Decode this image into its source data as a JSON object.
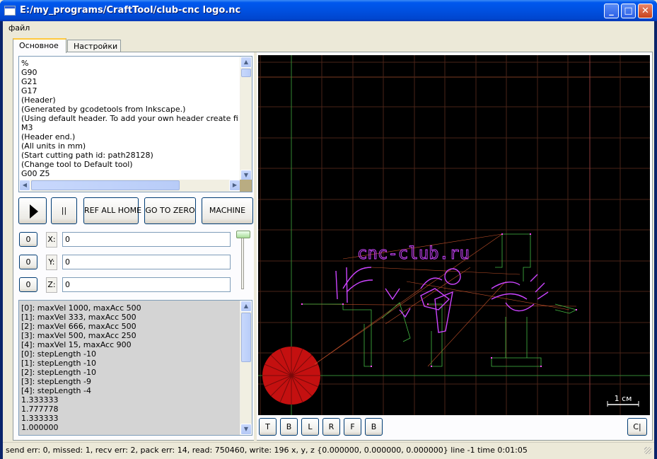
{
  "window": {
    "title": "E:/my_programs/CraftTool/club-cnc logo.nc",
    "minimize": "_",
    "maximize": "□",
    "close": "✕"
  },
  "menu": {
    "file": "файл"
  },
  "tabs": [
    {
      "label": "Основное",
      "active": true
    },
    {
      "label": "Настройки",
      "active": false
    }
  ],
  "gcode": {
    "lines": [
      "%",
      "G90",
      "G21",
      "G17",
      "(Header)",
      "(Generated by gcodetools from Inkscape.)",
      "(Using default header. To add your own header create file \"heade",
      "M3",
      "(Header end.)",
      "(All units in mm)",
      "(Start cutting path id: path28128)",
      "(Change tool to Default tool)",
      "G00 Z5"
    ]
  },
  "controls": {
    "play_icon": "play-icon",
    "pause_label": "||",
    "ref_all_home": "REF ALL HOME",
    "go_to_zero": "GO TO ZERO",
    "machine": "MACHINE"
  },
  "axes": [
    {
      "zero_label": "0",
      "axis": "X:",
      "value": "0"
    },
    {
      "zero_label": "0",
      "axis": "Y:",
      "value": "0"
    },
    {
      "zero_label": "0",
      "axis": "Z:",
      "value": "0"
    }
  ],
  "log": {
    "lines": [
      "[0]: maxVel 1000, maxAcc 500",
      "[1]: maxVel 333, maxAcc 500",
      "[2]: maxVel 666, maxAcc 500",
      "[3]: maxVel 500, maxAcc 250",
      "[4]: maxVel 15, maxAcc 900",
      "[0]: stepLength -10",
      "[1]: stepLength -10",
      "[2]: stepLength -10",
      "[3]: stepLength -9",
      "[4]: stepLength -4",
      "1.333333",
      "1.777778",
      "1.333333",
      "1.000000"
    ]
  },
  "preview": {
    "logo_text": "cnc-club.ru",
    "scale_label": "1 см",
    "colors": {
      "background": "#000000",
      "grid": "#5a2a1a",
      "axis": "#44bb44",
      "path": "#cc44ff",
      "travel": "#ff7744",
      "tool": "#cc1111"
    }
  },
  "view_buttons": [
    "T",
    "B",
    "L",
    "R",
    "F",
    "B"
  ],
  "clear_button": "C|",
  "status": "send err: 0, missed: 1, recv err: 2, pack err: 14, read: 750460, write: 196 x, y, z {0.000000, 0.000000, 0.000000} line -1 time 0:01:05"
}
